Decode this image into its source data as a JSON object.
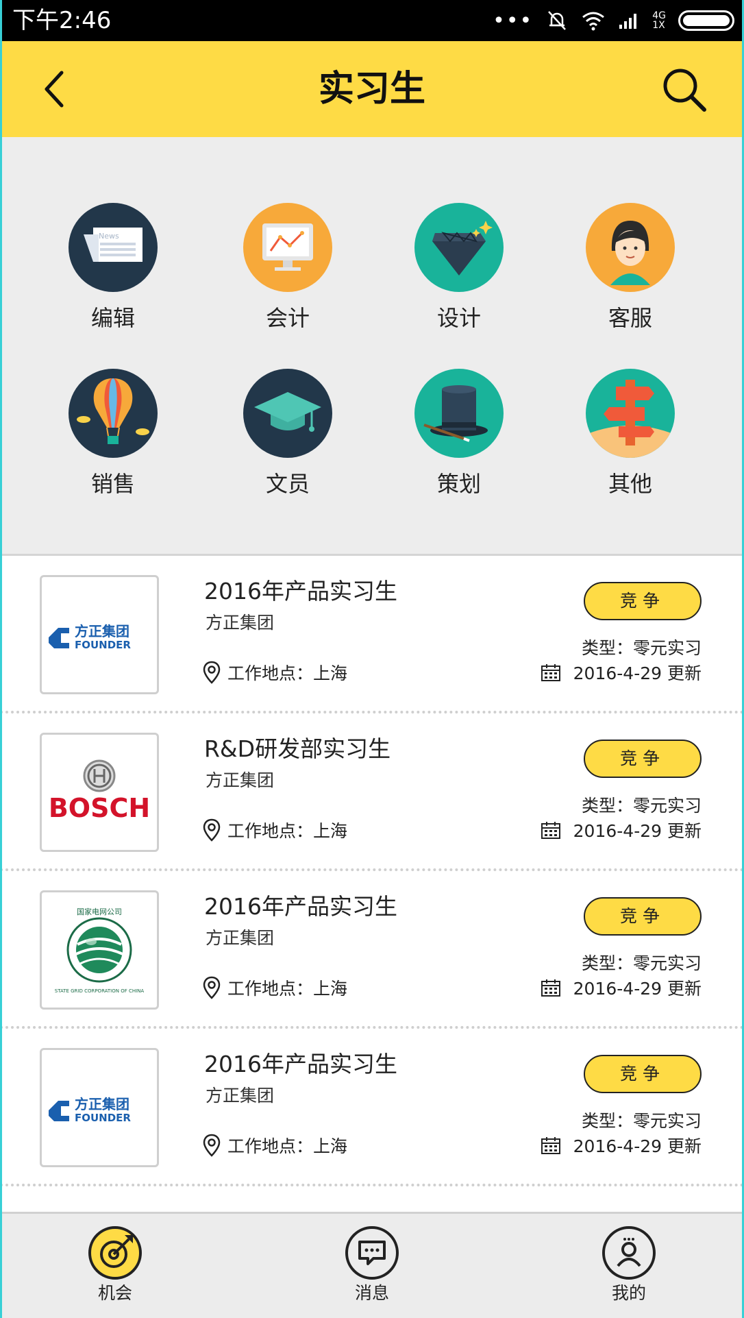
{
  "status_bar": {
    "time": "下午2:46",
    "network_top": "4G",
    "network_bottom": "1X"
  },
  "header": {
    "title": "实习生"
  },
  "categories": [
    {
      "label": "编辑",
      "icon": "news-icon",
      "icon_text": "News"
    },
    {
      "label": "会计",
      "icon": "chart-monitor-icon"
    },
    {
      "label": "设计",
      "icon": "diamond-icon"
    },
    {
      "label": "客服",
      "icon": "woman-avatar-icon"
    },
    {
      "label": "销售",
      "icon": "hot-air-balloon-icon"
    },
    {
      "label": "文员",
      "icon": "graduation-cap-icon"
    },
    {
      "label": "策划",
      "icon": "magic-hat-icon"
    },
    {
      "label": "其他",
      "icon": "signpost-icon"
    }
  ],
  "jobs": [
    {
      "title": "2016年产品实习生",
      "company": "方正集团",
      "location_label": "工作地点：上海",
      "button": "竞争",
      "type": "类型：零元实习",
      "updated": "2016-4-29 更新",
      "logo": {
        "name": "founder",
        "cn": "方正集团",
        "en": "FOUNDER"
      }
    },
    {
      "title": "R&D研发部实习生",
      "company": "方正集团",
      "location_label": "工作地点：上海",
      "button": "竞争",
      "type": "类型：零元实习",
      "updated": "2016-4-29 更新",
      "logo": {
        "name": "bosch",
        "en": "BOSCH"
      }
    },
    {
      "title": "2016年产品实习生",
      "company": "方正集团",
      "location_label": "工作地点：上海",
      "button": "竞争",
      "type": "类型：零元实习",
      "updated": "2016-4-29 更新",
      "logo": {
        "name": "state-grid",
        "cn": "国家电网公司",
        "en": "STATE GRID CORPORATION OF CHINA"
      }
    },
    {
      "title": "2016年产品实习生",
      "company": "方正集团",
      "location_label": "工作地点：上海",
      "button": "竞争",
      "type": "类型：零元实习",
      "updated": "2016-4-29 更新",
      "logo": {
        "name": "founder",
        "cn": "方正集团",
        "en": "FOUNDER"
      }
    }
  ],
  "tabs": [
    {
      "label": "机会",
      "icon": "target-icon",
      "active": true
    },
    {
      "label": "消息",
      "icon": "message-icon",
      "active": false
    },
    {
      "label": "我的",
      "icon": "profile-icon",
      "active": false
    }
  ],
  "colors": {
    "accent": "#fedb45",
    "navy": "#22374a",
    "teal": "#19b39a",
    "orange": "#f7a93a"
  }
}
